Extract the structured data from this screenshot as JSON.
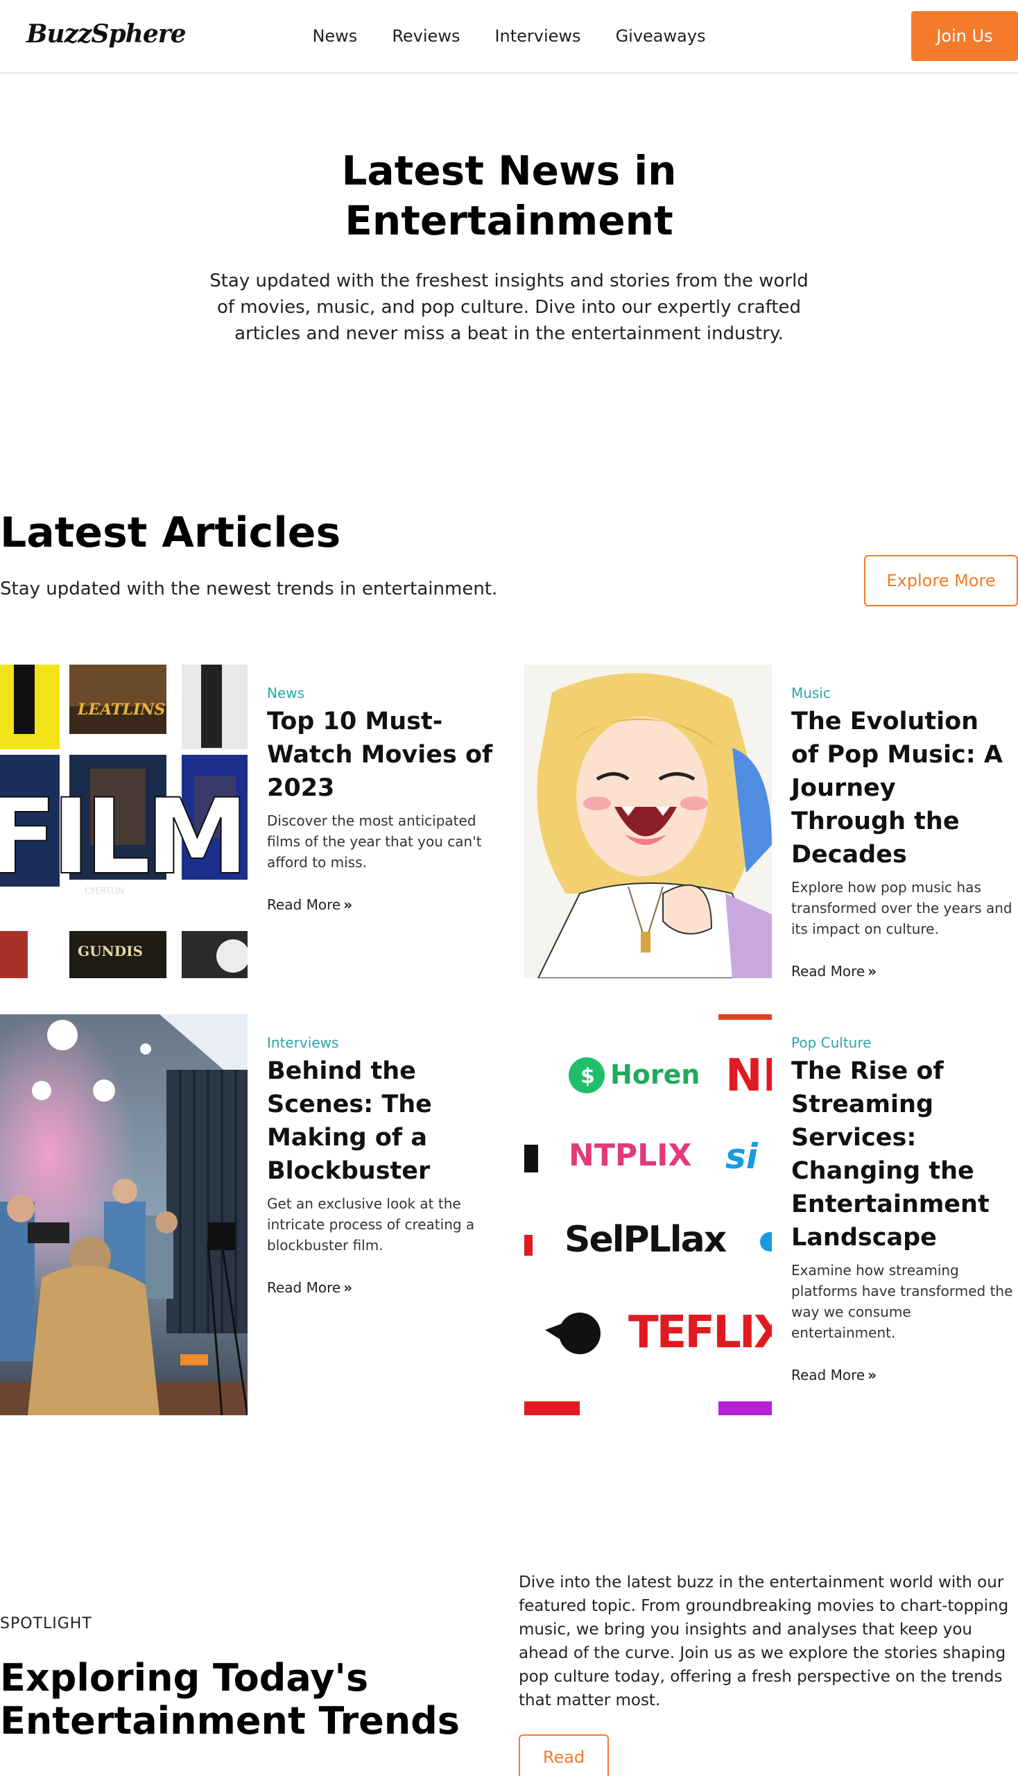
{
  "header": {
    "logo": "BuzzSphere",
    "nav": [
      "News",
      "Reviews",
      "Interviews",
      "Giveaways"
    ],
    "join_label": "Join Us"
  },
  "hero": {
    "title": "Latest News in Entertainment",
    "text": "Stay updated with the freshest insights and stories from the world of movies, music, and pop culture. Dive into our expertly crafted articles and never miss a beat in the entertainment industry."
  },
  "latest": {
    "title": "Latest Articles",
    "subtitle": "Stay updated with the newest trends in entertainment.",
    "explore_label": "Explore More"
  },
  "articles": [
    {
      "category": "News",
      "title": "Top 10 Must-Watch Movies of 2023",
      "desc": "Discover the most anticipated films of the year that you can't afford to miss.",
      "read_more": "Read More",
      "image": {
        "big_text": "FILMS",
        "poster_1": "LEATLINS",
        "poster_2": "GUNDIS",
        "poster_3": "CYERTLIN"
      }
    },
    {
      "category": "Music",
      "title": "The Evolution of Pop Music: A Journey Through the Decades",
      "desc": "Explore how pop music has transformed over the years and its impact on culture.",
      "read_more": "Read More"
    },
    {
      "category": "Interviews",
      "title": "Behind the Scenes: The Making of a Blockbuster",
      "desc": "Get an exclusive look at the intricate process of creating a blockbuster film.",
      "read_more": "Read More"
    },
    {
      "category": "Pop Culture",
      "title": "The Rise of Streaming Services: Changing the Entertainment Landscape",
      "desc": "Examine how streaming platforms have transformed the way we consume entertainment.",
      "read_more": "Read More",
      "image": {
        "logo_1": "Horen",
        "logo_2": "NTPLIX",
        "logo_3": "SelPLlax",
        "logo_4": "TEFLIX",
        "logo_5": "NE",
        "logo_6": "si"
      }
    }
  ],
  "spotlight": {
    "label": "SPOTLIGHT",
    "title": "Exploring Today's Entertainment Trends",
    "text": "Dive into the latest buzz in the entertainment world with our featured topic. From groundbreaking movies to chart-topping music, we bring you insights and analyses that keep you ahead of the curve. Join us as we explore the stories shaping pop culture today, offering a fresh perspective on the trends that matter most.",
    "read_label": "Read"
  },
  "colors": {
    "accent": "#f47b2a",
    "category": "#2aa7a7"
  }
}
